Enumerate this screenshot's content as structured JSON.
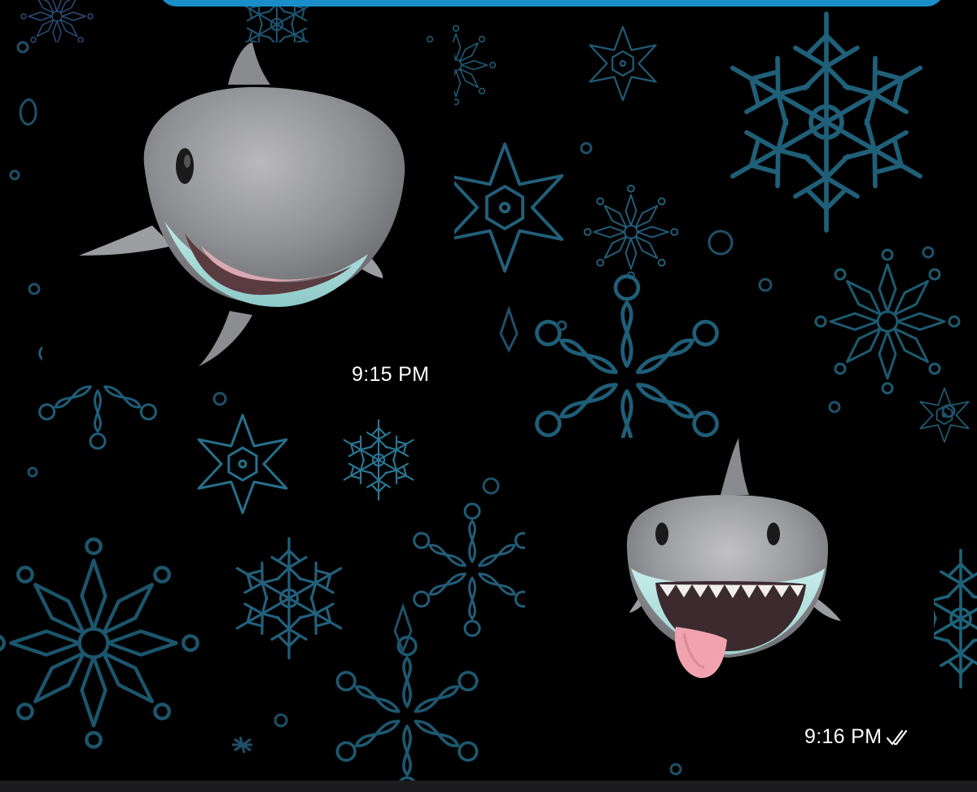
{
  "messages": [
    {
      "direction": "incoming",
      "media": "shark-animoji-video",
      "time": "9:15 PM"
    },
    {
      "direction": "outgoing",
      "media": "shark-animoji-video",
      "time": "9:16 PM",
      "status_icon": "double-check-icon"
    }
  ],
  "colors": {
    "wallpaper_bg": "#000000",
    "snowflake_line": "#1f5f78",
    "snowflake_line_alt": "#2a7896",
    "bubble_accent": "#1a8ec9",
    "timestamp_text": "#ffffff"
  },
  "wallpaper": "snowflake-pattern"
}
